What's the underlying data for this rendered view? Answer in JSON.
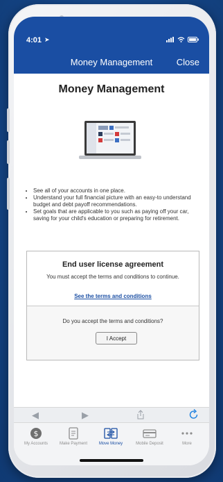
{
  "status": {
    "time": "4:01"
  },
  "nav": {
    "title": "Money Management",
    "close_label": "Close"
  },
  "content": {
    "title": "Money Management",
    "bullets": [
      "See all of your accounts in one place.",
      "Understand your full financial picture with an easy-to understand budget and debt payoff recommendations.",
      "Set goals that are applicable to you such as paying off your car, saving for your child's education or preparing for retirement."
    ]
  },
  "eula": {
    "title": "End user license agreement",
    "subtitle": "You must accept the terms and conditions to continue.",
    "link": "See the terms and conditions",
    "question": "Do you accept the terms and conditions?",
    "accept_label": "I Accept"
  },
  "tabs": [
    {
      "label": "My Accounts",
      "icon": "dollar-coin-icon",
      "active": false
    },
    {
      "label": "Make Payment",
      "icon": "document-icon",
      "active": false
    },
    {
      "label": "Move Money",
      "icon": "transfer-icon",
      "active": true
    },
    {
      "label": "Mobile Deposit",
      "icon": "check-deposit-icon",
      "active": false
    },
    {
      "label": "More",
      "icon": "ellipsis-icon",
      "active": false
    }
  ],
  "colors": {
    "brand": "#1a4ea3",
    "background": "#174b91"
  }
}
